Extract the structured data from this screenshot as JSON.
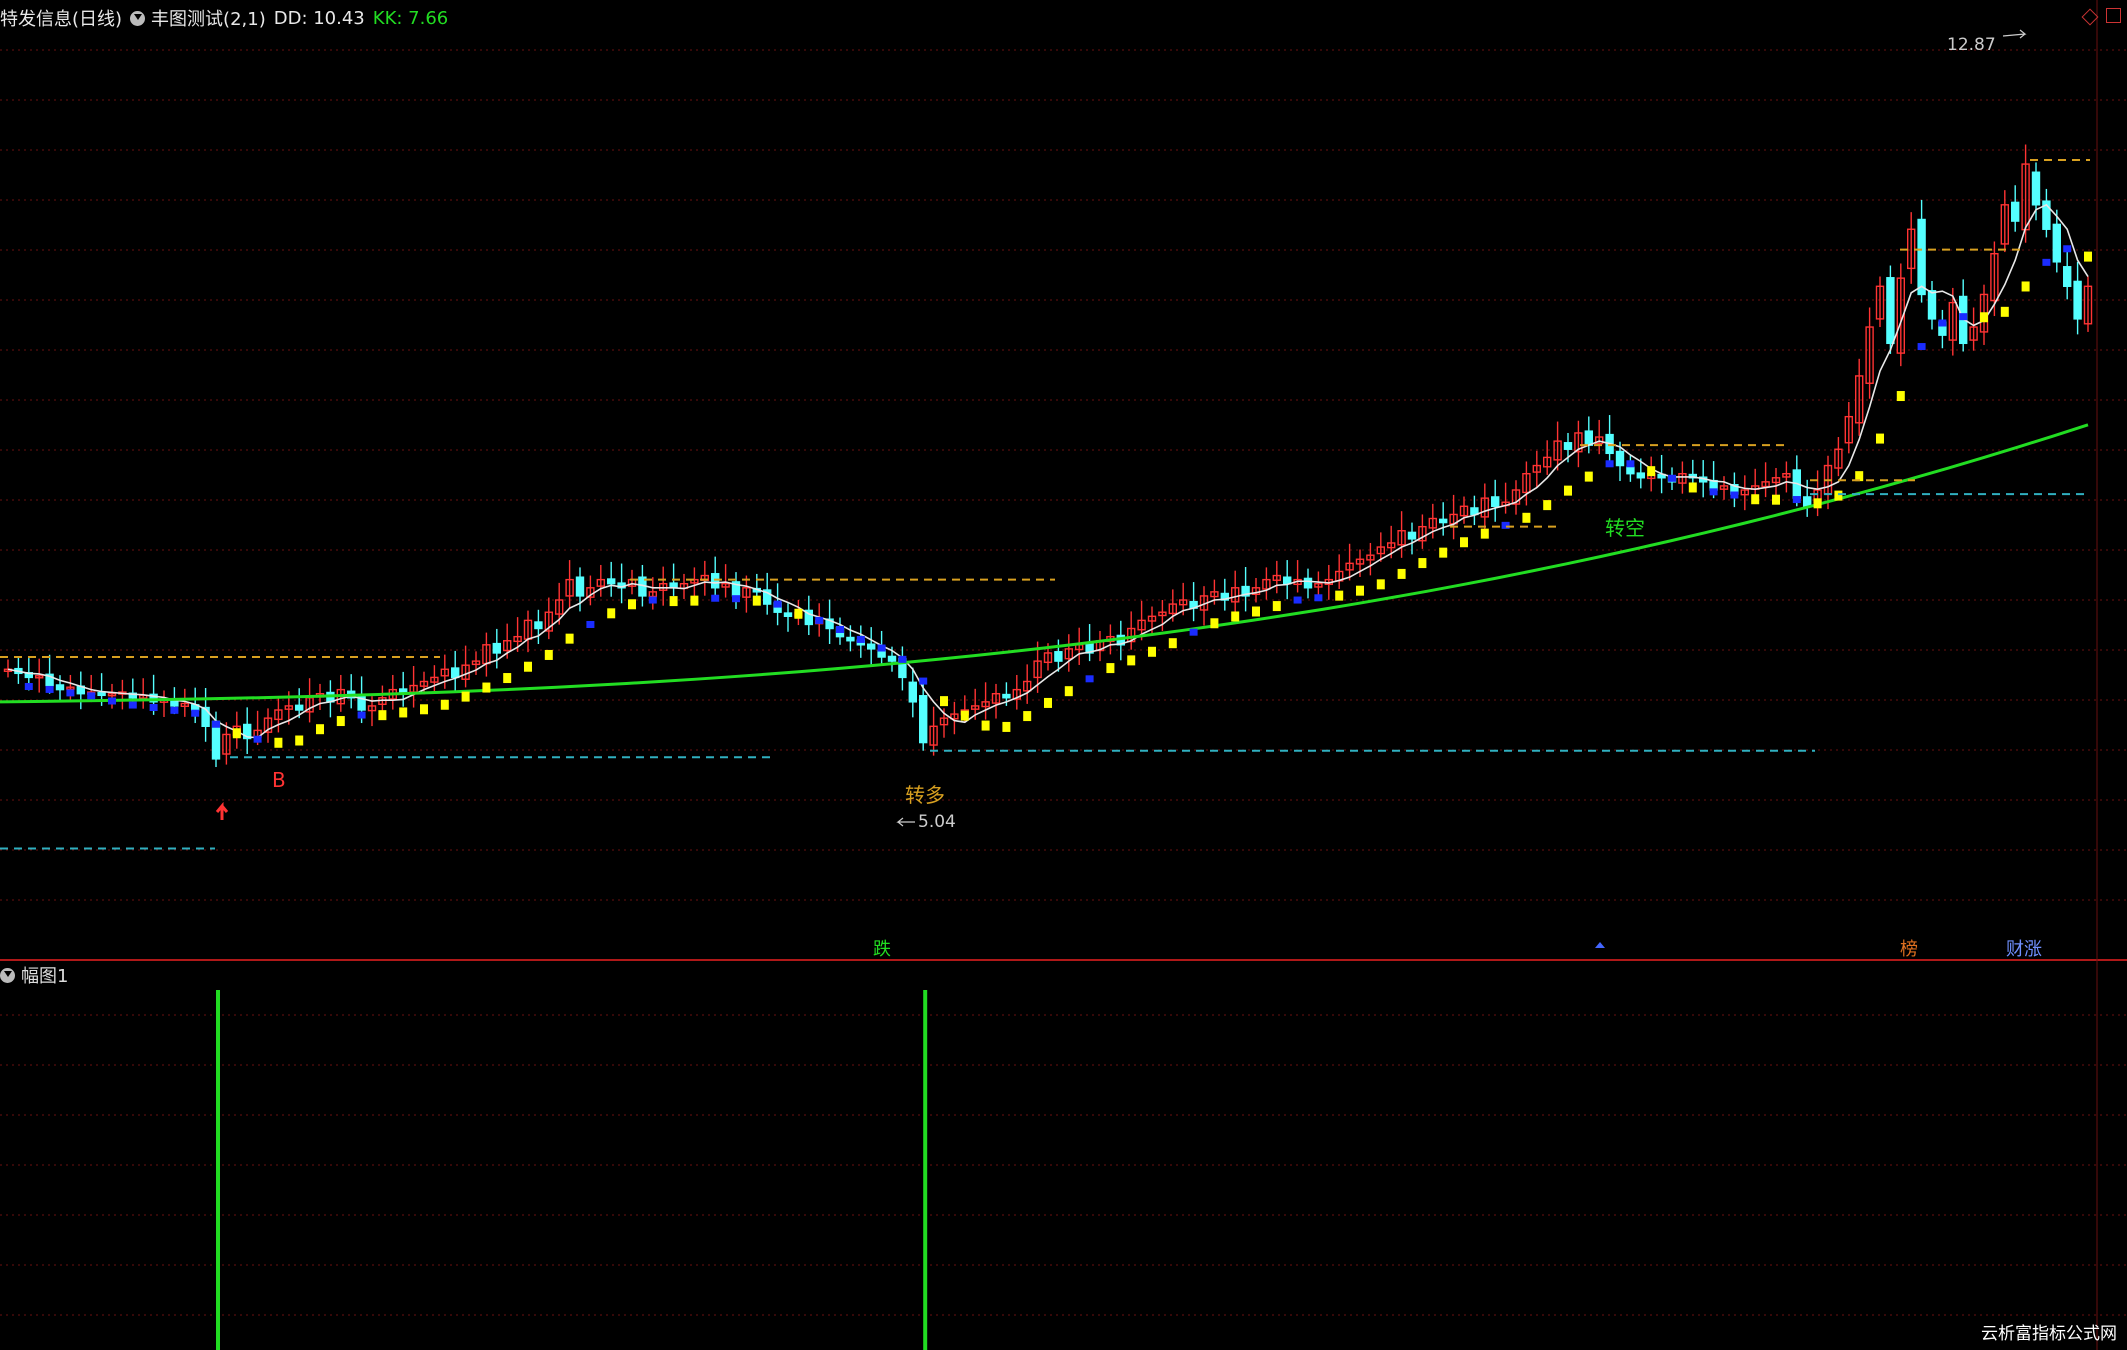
{
  "header": {
    "stock_name": "特发信息(日线)",
    "indicator_name": "丰图测试(2,1)",
    "dd_label": "DD: 10.43",
    "kk_label": "KK: 7.66",
    "colors": {
      "dd": "#e8e8e8",
      "kk": "#22dd22"
    }
  },
  "sub_panel": {
    "title": "幅图1"
  },
  "watermark": "云析富指标公式网",
  "chart_data": {
    "type": "candlestick",
    "price_range": [
      3.0,
      13.8
    ],
    "grid": true,
    "up_color": "#ff3333",
    "down_color": "#54ffff",
    "closes": [
      6.2,
      6.15,
      6.1,
      6.12,
      6.0,
      5.95,
      5.98,
      5.9,
      5.92,
      5.88,
      5.9,
      5.92,
      5.85,
      5.88,
      5.8,
      5.82,
      5.75,
      5.78,
      5.7,
      5.5,
      5.1,
      5.4,
      5.5,
      5.35,
      5.45,
      5.6,
      5.7,
      5.75,
      5.7,
      5.85,
      5.9,
      5.8,
      5.95,
      5.85,
      5.7,
      5.75,
      5.85,
      5.95,
      5.9,
      6.0,
      6.05,
      6.1,
      6.2,
      6.1,
      6.25,
      6.3,
      6.5,
      6.4,
      6.55,
      6.6,
      6.8,
      6.7,
      6.9,
      7.05,
      7.3,
      7.1,
      7.2,
      7.3,
      7.25,
      7.2,
      7.3,
      7.1,
      7.15,
      7.25,
      7.2,
      7.25,
      7.3,
      7.35,
      7.2,
      7.25,
      7.1,
      7.2,
      7.15,
      7.0,
      6.9,
      6.85,
      6.9,
      6.75,
      6.8,
      6.7,
      6.6,
      6.55,
      6.5,
      6.45,
      6.35,
      6.3,
      6.1,
      5.8,
      5.3,
      5.5,
      5.6,
      5.65,
      5.7,
      5.75,
      5.8,
      5.9,
      5.85,
      5.95,
      6.05,
      6.3,
      6.4,
      6.3,
      6.45,
      6.5,
      6.4,
      6.55,
      6.6,
      6.5,
      6.7,
      6.8,
      6.85,
      6.9,
      7.0,
      7.05,
      6.95,
      7.1,
      7.15,
      7.05,
      7.2,
      7.1,
      7.2,
      7.3,
      7.35,
      7.25,
      7.3,
      7.2,
      7.25,
      7.3,
      7.4,
      7.5,
      7.55,
      7.6,
      7.7,
      7.75,
      7.9,
      7.8,
      7.95,
      8.05,
      8.0,
      8.1,
      8.2,
      8.1,
      8.3,
      8.2,
      8.25,
      8.4,
      8.6,
      8.7,
      8.8,
      9.0,
      8.9,
      9.1,
      8.95,
      9.05,
      8.85,
      8.7,
      8.6,
      8.55,
      8.6,
      8.55,
      8.5,
      8.6,
      8.55,
      8.5,
      8.4,
      8.45,
      8.35,
      8.4,
      8.45,
      8.5,
      8.55,
      8.6,
      8.3,
      8.2,
      8.4,
      8.7,
      8.9,
      9.3,
      9.8,
      10.4,
      10.9,
      10.2,
      11.0,
      11.6,
      10.8,
      10.5,
      10.3,
      10.7,
      10.2,
      10.4,
      10.8,
      11.3,
      11.9,
      11.7,
      12.4,
      11.9,
      11.6,
      11.2,
      10.9,
      10.5,
      10.9
    ],
    "ma_green_endpoints": {
      "start": 5.8,
      "end": 8.9
    },
    "annotations": [
      {
        "text": "12.87",
        "type": "price-high"
      },
      {
        "text": "5.04",
        "type": "price-low"
      },
      {
        "text": "转空",
        "type": "signal"
      },
      {
        "text": "转多",
        "type": "signal"
      },
      {
        "text": "B",
        "type": "signal"
      },
      {
        "text": "跌",
        "type": "bottom-label"
      },
      {
        "text": "榜",
        "type": "bottom-label"
      },
      {
        "text": "财涨",
        "type": "bottom-label"
      }
    ],
    "sub_bars_at": [
      20,
      88
    ]
  }
}
